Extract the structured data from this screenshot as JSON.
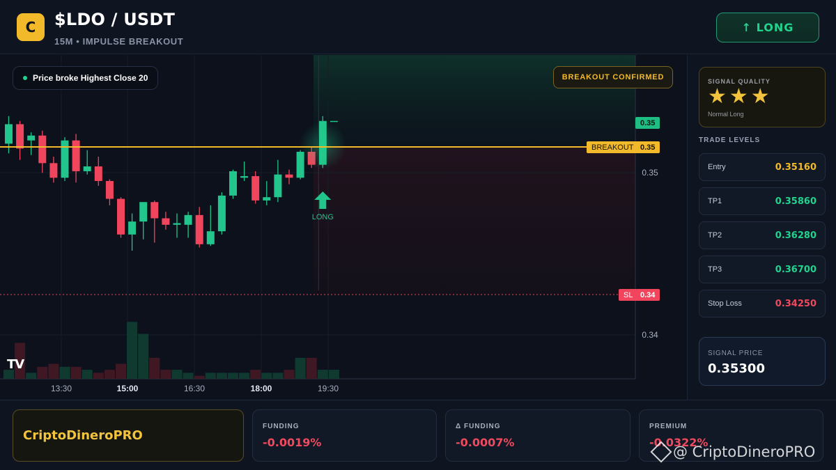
{
  "header": {
    "logo_letter": "C",
    "pair": "$LDO / USDT",
    "subtitle": "15M • IMPULSE BREAKOUT",
    "direction_label": "↑ LONG"
  },
  "chart": {
    "condition_text": "Price broke Highest Close 20",
    "confirm_badge": "BREAKOUT CONFIRMED",
    "signal_marker_label": "LONG",
    "breakout_line_label": "BREAKOUT",
    "breakout_line_value": "0.35",
    "sl_line_label": "SL",
    "sl_line_value": "0.34",
    "current_price_tag": "0.35",
    "platform_logo": "TV",
    "colors": {
      "up": "#22c58b",
      "down": "#f0455c",
      "breakout": "#f2b92a",
      "sl": "#f0455c"
    }
  },
  "chart_data": {
    "type": "candlestick",
    "x_ticks": [
      "13:30",
      "15:00",
      "16:30",
      "18:00",
      "19:30"
    ],
    "y_ticks": [
      "0.35",
      "0.34"
    ],
    "breakout_level": 0.3516,
    "stop_loss": 0.3425,
    "candles": [
      {
        "o": 0.3518,
        "h": 0.3535,
        "l": 0.3512,
        "c": 0.353
      },
      {
        "o": 0.353,
        "h": 0.3532,
        "l": 0.3508,
        "c": 0.3515
      },
      {
        "o": 0.352,
        "h": 0.3525,
        "l": 0.3511,
        "c": 0.3523
      },
      {
        "o": 0.3523,
        "h": 0.3526,
        "l": 0.35,
        "c": 0.3506
      },
      {
        "o": 0.3506,
        "h": 0.351,
        "l": 0.3494,
        "c": 0.3497
      },
      {
        "o": 0.3497,
        "h": 0.3522,
        "l": 0.3495,
        "c": 0.352
      },
      {
        "o": 0.352,
        "h": 0.3524,
        "l": 0.3494,
        "c": 0.3501
      },
      {
        "o": 0.3501,
        "h": 0.3514,
        "l": 0.3499,
        "c": 0.3504
      },
      {
        "o": 0.3504,
        "h": 0.351,
        "l": 0.3492,
        "c": 0.3495
      },
      {
        "o": 0.3495,
        "h": 0.3496,
        "l": 0.348,
        "c": 0.3484
      },
      {
        "o": 0.3484,
        "h": 0.3485,
        "l": 0.346,
        "c": 0.3462
      },
      {
        "o": 0.3462,
        "h": 0.3475,
        "l": 0.3452,
        "c": 0.347
      },
      {
        "o": 0.347,
        "h": 0.3482,
        "l": 0.3459,
        "c": 0.3482
      },
      {
        "o": 0.3482,
        "h": 0.3483,
        "l": 0.3457,
        "c": 0.3472
      },
      {
        "o": 0.3472,
        "h": 0.3476,
        "l": 0.3465,
        "c": 0.3468
      },
      {
        "o": 0.3468,
        "h": 0.3475,
        "l": 0.346,
        "c": 0.3469
      },
      {
        "o": 0.3468,
        "h": 0.3476,
        "l": 0.346,
        "c": 0.3474
      },
      {
        "o": 0.3474,
        "h": 0.3479,
        "l": 0.3454,
        "c": 0.3456
      },
      {
        "o": 0.3456,
        "h": 0.348,
        "l": 0.3455,
        "c": 0.3464
      },
      {
        "o": 0.3464,
        "h": 0.3488,
        "l": 0.3462,
        "c": 0.3486
      },
      {
        "o": 0.3486,
        "h": 0.3502,
        "l": 0.3484,
        "c": 0.3501
      },
      {
        "o": 0.3497,
        "h": 0.3507,
        "l": 0.3495,
        "c": 0.3498
      },
      {
        "o": 0.3498,
        "h": 0.3501,
        "l": 0.3481,
        "c": 0.3483
      },
      {
        "o": 0.3483,
        "h": 0.3495,
        "l": 0.348,
        "c": 0.3485
      },
      {
        "o": 0.3485,
        "h": 0.3508,
        "l": 0.3482,
        "c": 0.3499
      },
      {
        "o": 0.3499,
        "h": 0.3502,
        "l": 0.3493,
        "c": 0.3497
      },
      {
        "o": 0.3497,
        "h": 0.3514,
        "l": 0.3496,
        "c": 0.3513
      },
      {
        "o": 0.3513,
        "h": 0.3516,
        "l": 0.3503,
        "c": 0.3505
      },
      {
        "o": 0.3505,
        "h": 0.3535,
        "l": 0.3503,
        "c": 0.3532
      },
      {
        "o": 0.3532,
        "h": 0.3532,
        "l": 0.3532,
        "c": 0.3532
      }
    ],
    "volume": [
      3,
      12,
      2,
      4,
      5,
      4,
      4,
      3,
      2,
      3,
      5,
      19,
      15,
      7,
      3,
      3,
      2,
      1,
      2,
      2,
      2,
      2,
      3,
      2,
      2,
      3,
      7,
      7,
      3,
      3
    ]
  },
  "quality": {
    "label": "SIGNAL QUALITY",
    "stars": "★★★",
    "sub": "Normal Long"
  },
  "trade_levels": {
    "title": "TRADE LEVELS",
    "items": [
      {
        "name": "Entry",
        "value": "0.35160",
        "color": "#f2b92a"
      },
      {
        "name": "TP1",
        "value": "0.35860",
        "color": "#22d38e"
      },
      {
        "name": "TP2",
        "value": "0.36280",
        "color": "#22d38e"
      },
      {
        "name": "TP3",
        "value": "0.36700",
        "color": "#22d38e"
      },
      {
        "name": "Stop Loss",
        "value": "0.34250",
        "color": "#f04a5e"
      }
    ]
  },
  "signal_price": {
    "label": "SIGNAL PRICE",
    "value": "0.35300"
  },
  "footer": {
    "brand": "CriptoDineroPRO",
    "metrics": [
      {
        "label": "FUNDING",
        "value": "-0.0019%"
      },
      {
        "label": "Δ FUNDING",
        "value": "-0.0007%"
      },
      {
        "label": "PREMIUM",
        "value": "-0.0322%"
      }
    ],
    "watermark": "@ CriptoDineroPRO"
  }
}
